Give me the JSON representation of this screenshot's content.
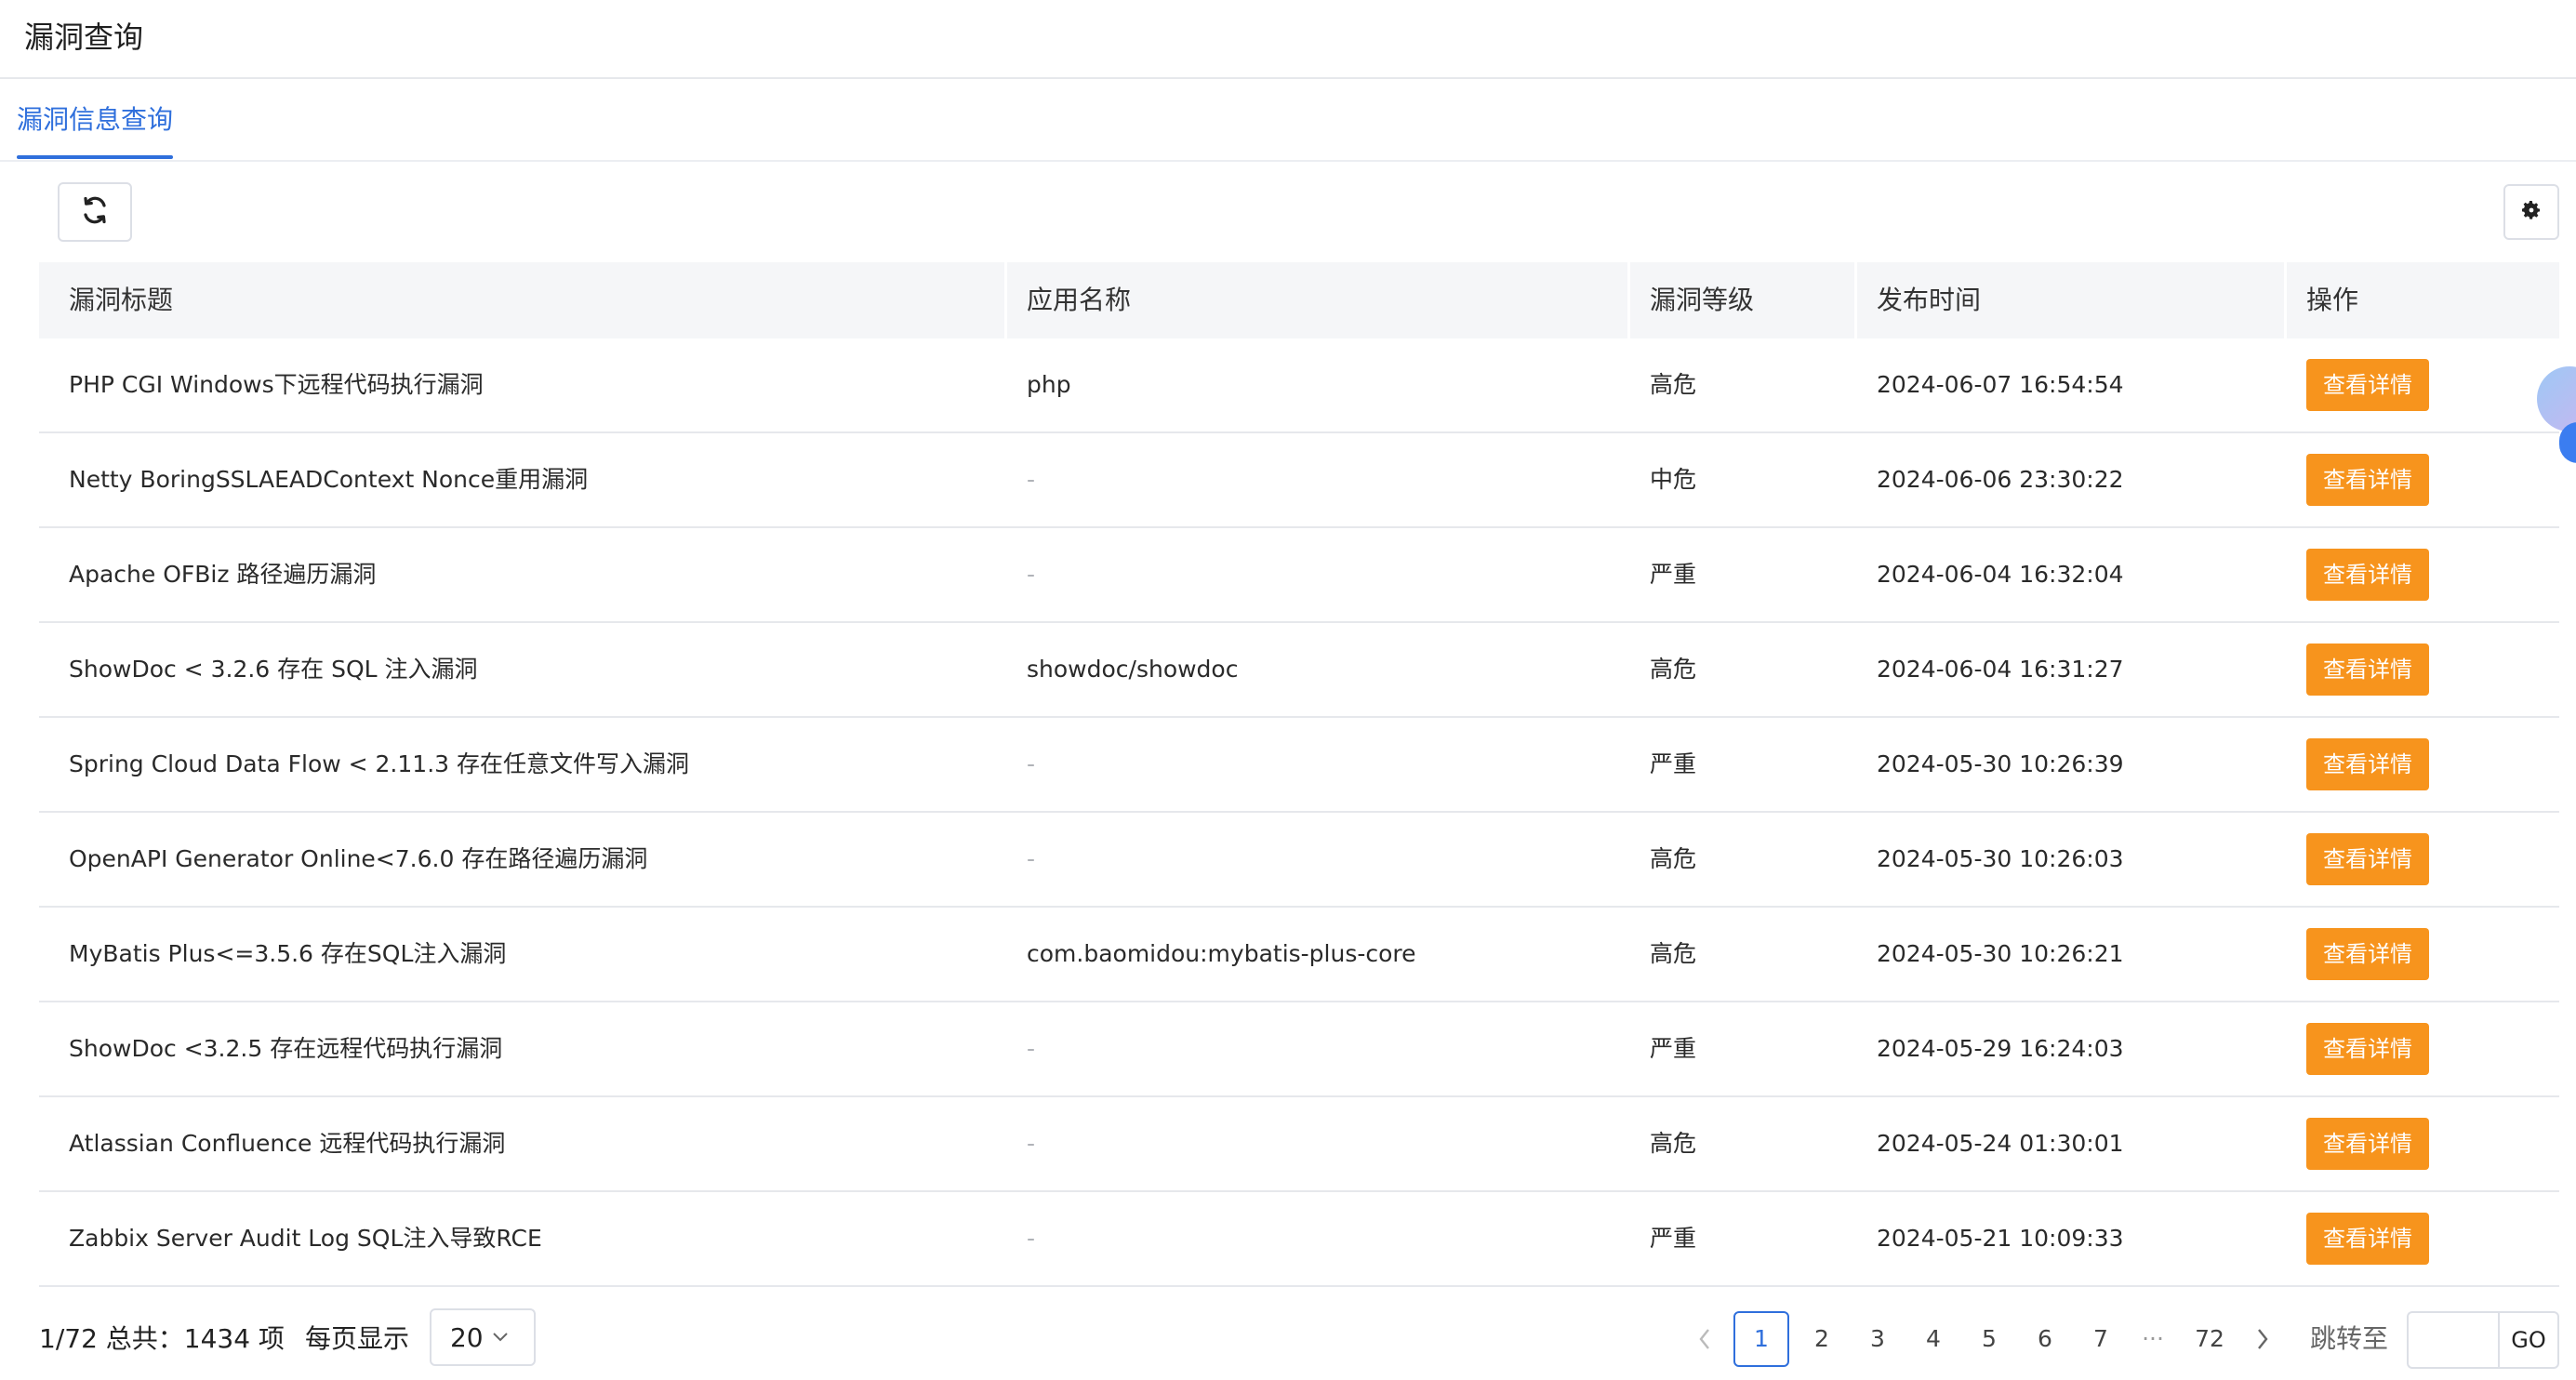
{
  "header": {
    "title": "漏洞查询"
  },
  "tabs": [
    {
      "label": "漏洞信息查询",
      "active": true
    }
  ],
  "toolbar": {
    "refresh_icon": "refresh-icon",
    "settings_icon": "gear-icon"
  },
  "table": {
    "columns": [
      "漏洞标题",
      "应用名称",
      "漏洞等级",
      "发布时间",
      "操作"
    ],
    "rows": [
      {
        "title": "PHP CGI Windows下远程代码执行漏洞",
        "app": "php",
        "level": "高危",
        "time": "2024-06-07 16:54:54",
        "action": "查看详情"
      },
      {
        "title": "Netty BoringSSLAEADContext Nonce重用漏洞",
        "app": "-",
        "level": "中危",
        "time": "2024-06-06 23:30:22",
        "action": "查看详情"
      },
      {
        "title": "Apache OFBiz 路径遍历漏洞",
        "app": "-",
        "level": "严重",
        "time": "2024-06-04 16:32:04",
        "action": "查看详情"
      },
      {
        "title": "ShowDoc < 3.2.6 存在 SQL 注入漏洞",
        "app": "showdoc/showdoc",
        "level": "高危",
        "time": "2024-06-04 16:31:27",
        "action": "查看详情"
      },
      {
        "title": "Spring Cloud Data Flow < 2.11.3 存在任意文件写入漏洞",
        "app": "-",
        "level": "严重",
        "time": "2024-05-30 10:26:39",
        "action": "查看详情"
      },
      {
        "title": "OpenAPI Generator Online<7.6.0 存在路径遍历漏洞",
        "app": "-",
        "level": "高危",
        "time": "2024-05-30 10:26:03",
        "action": "查看详情"
      },
      {
        "title": "MyBatis Plus<=3.5.6 存在SQL注入漏洞",
        "app": "com.baomidou:mybatis-plus-core",
        "level": "高危",
        "time": "2024-05-30 10:26:21",
        "action": "查看详情"
      },
      {
        "title": "ShowDoc <3.2.5 存在远程代码执行漏洞",
        "app": "-",
        "level": "严重",
        "time": "2024-05-29 16:24:03",
        "action": "查看详情"
      },
      {
        "title": "Atlassian Confluence 远程代码执行漏洞",
        "app": "-",
        "level": "高危",
        "time": "2024-05-24 01:30:01",
        "action": "查看详情"
      },
      {
        "title": "Zabbix Server Audit Log SQL注入导致RCE",
        "app": "-",
        "level": "严重",
        "time": "2024-05-21 10:09:33",
        "action": "查看详情"
      }
    ]
  },
  "footer": {
    "total_text": "1/72 总共：1434 项",
    "page_size_label": "每页显示",
    "page_size": "20",
    "pages": [
      "1",
      "2",
      "3",
      "4",
      "5",
      "6",
      "7"
    ],
    "ellipsis": "···",
    "last_page": "72",
    "current_page": "1",
    "jump_label": "跳转至",
    "go_label": "GO"
  },
  "colors": {
    "accent": "#2f6fdc",
    "action_button": "#f7941d"
  }
}
